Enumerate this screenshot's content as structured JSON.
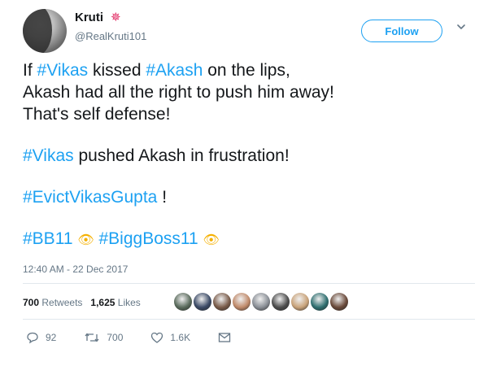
{
  "user": {
    "display_name": "Kruti",
    "name_emoji": "✵",
    "handle": "@RealKruti101"
  },
  "follow_label": "Follow",
  "tweet": {
    "l1_prefix": "If ",
    "l1_tag1": "#Vikas",
    "l1_mid": " kissed ",
    "l1_tag2": "#Akash",
    "l1_suffix": " on the lips,",
    "l2": "Akash had all the right to push him away!",
    "l3": "That's self defense!",
    "l4_tag": "#Vikas",
    "l4_rest": " pushed Akash in frustration!",
    "l5_tag": "#EvictVikasGupta",
    "l5_rest": " !",
    "tag_bb11": "#BB11",
    "tag_biggboss": "#BiggBoss11",
    "eyes_emoji": "👁"
  },
  "timestamp": "12:40 AM - 22 Dec 2017",
  "stats": {
    "retweets_count": "700",
    "retweets_label": "Retweets",
    "likes_count": "1,625",
    "likes_label": "Likes"
  },
  "likers_colors": [
    "#5a6b5c",
    "#3b4a66",
    "#7a5c4a",
    "#c08a6a",
    "#8a8f96",
    "#4d4d4d",
    "#c9a37a",
    "#2f6f70",
    "#6a4a3a"
  ],
  "actions": {
    "reply_count": "92",
    "retweet_count": "700",
    "like_count": "1.6K"
  },
  "colors": {
    "accent": "#1da1f2",
    "muted": "#657786",
    "text": "#14171a"
  }
}
